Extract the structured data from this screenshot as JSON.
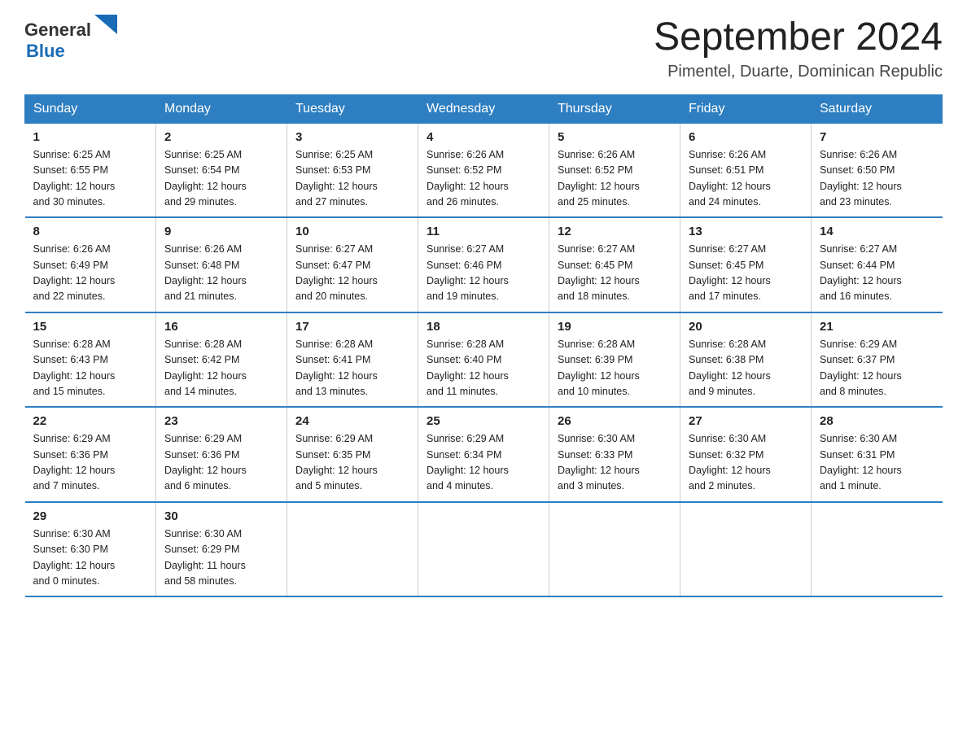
{
  "logo": {
    "general": "General",
    "blue": "Blue"
  },
  "title": "September 2024",
  "location": "Pimentel, Duarte, Dominican Republic",
  "weekdays": [
    "Sunday",
    "Monday",
    "Tuesday",
    "Wednesday",
    "Thursday",
    "Friday",
    "Saturday"
  ],
  "weeks": [
    [
      {
        "day": "1",
        "sunrise": "6:25 AM",
        "sunset": "6:55 PM",
        "daylight": "12 hours and 30 minutes."
      },
      {
        "day": "2",
        "sunrise": "6:25 AM",
        "sunset": "6:54 PM",
        "daylight": "12 hours and 29 minutes."
      },
      {
        "day": "3",
        "sunrise": "6:25 AM",
        "sunset": "6:53 PM",
        "daylight": "12 hours and 27 minutes."
      },
      {
        "day": "4",
        "sunrise": "6:26 AM",
        "sunset": "6:52 PM",
        "daylight": "12 hours and 26 minutes."
      },
      {
        "day": "5",
        "sunrise": "6:26 AM",
        "sunset": "6:52 PM",
        "daylight": "12 hours and 25 minutes."
      },
      {
        "day": "6",
        "sunrise": "6:26 AM",
        "sunset": "6:51 PM",
        "daylight": "12 hours and 24 minutes."
      },
      {
        "day": "7",
        "sunrise": "6:26 AM",
        "sunset": "6:50 PM",
        "daylight": "12 hours and 23 minutes."
      }
    ],
    [
      {
        "day": "8",
        "sunrise": "6:26 AM",
        "sunset": "6:49 PM",
        "daylight": "12 hours and 22 minutes."
      },
      {
        "day": "9",
        "sunrise": "6:26 AM",
        "sunset": "6:48 PM",
        "daylight": "12 hours and 21 minutes."
      },
      {
        "day": "10",
        "sunrise": "6:27 AM",
        "sunset": "6:47 PM",
        "daylight": "12 hours and 20 minutes."
      },
      {
        "day": "11",
        "sunrise": "6:27 AM",
        "sunset": "6:46 PM",
        "daylight": "12 hours and 19 minutes."
      },
      {
        "day": "12",
        "sunrise": "6:27 AM",
        "sunset": "6:45 PM",
        "daylight": "12 hours and 18 minutes."
      },
      {
        "day": "13",
        "sunrise": "6:27 AM",
        "sunset": "6:45 PM",
        "daylight": "12 hours and 17 minutes."
      },
      {
        "day": "14",
        "sunrise": "6:27 AM",
        "sunset": "6:44 PM",
        "daylight": "12 hours and 16 minutes."
      }
    ],
    [
      {
        "day": "15",
        "sunrise": "6:28 AM",
        "sunset": "6:43 PM",
        "daylight": "12 hours and 15 minutes."
      },
      {
        "day": "16",
        "sunrise": "6:28 AM",
        "sunset": "6:42 PM",
        "daylight": "12 hours and 14 minutes."
      },
      {
        "day": "17",
        "sunrise": "6:28 AM",
        "sunset": "6:41 PM",
        "daylight": "12 hours and 13 minutes."
      },
      {
        "day": "18",
        "sunrise": "6:28 AM",
        "sunset": "6:40 PM",
        "daylight": "12 hours and 11 minutes."
      },
      {
        "day": "19",
        "sunrise": "6:28 AM",
        "sunset": "6:39 PM",
        "daylight": "12 hours and 10 minutes."
      },
      {
        "day": "20",
        "sunrise": "6:28 AM",
        "sunset": "6:38 PM",
        "daylight": "12 hours and 9 minutes."
      },
      {
        "day": "21",
        "sunrise": "6:29 AM",
        "sunset": "6:37 PM",
        "daylight": "12 hours and 8 minutes."
      }
    ],
    [
      {
        "day": "22",
        "sunrise": "6:29 AM",
        "sunset": "6:36 PM",
        "daylight": "12 hours and 7 minutes."
      },
      {
        "day": "23",
        "sunrise": "6:29 AM",
        "sunset": "6:36 PM",
        "daylight": "12 hours and 6 minutes."
      },
      {
        "day": "24",
        "sunrise": "6:29 AM",
        "sunset": "6:35 PM",
        "daylight": "12 hours and 5 minutes."
      },
      {
        "day": "25",
        "sunrise": "6:29 AM",
        "sunset": "6:34 PM",
        "daylight": "12 hours and 4 minutes."
      },
      {
        "day": "26",
        "sunrise": "6:30 AM",
        "sunset": "6:33 PM",
        "daylight": "12 hours and 3 minutes."
      },
      {
        "day": "27",
        "sunrise": "6:30 AM",
        "sunset": "6:32 PM",
        "daylight": "12 hours and 2 minutes."
      },
      {
        "day": "28",
        "sunrise": "6:30 AM",
        "sunset": "6:31 PM",
        "daylight": "12 hours and 1 minute."
      }
    ],
    [
      {
        "day": "29",
        "sunrise": "6:30 AM",
        "sunset": "6:30 PM",
        "daylight": "12 hours and 0 minutes."
      },
      {
        "day": "30",
        "sunrise": "6:30 AM",
        "sunset": "6:29 PM",
        "daylight": "11 hours and 58 minutes."
      },
      null,
      null,
      null,
      null,
      null
    ]
  ],
  "labels": {
    "sunrise": "Sunrise:",
    "sunset": "Sunset:",
    "daylight": "Daylight:"
  }
}
